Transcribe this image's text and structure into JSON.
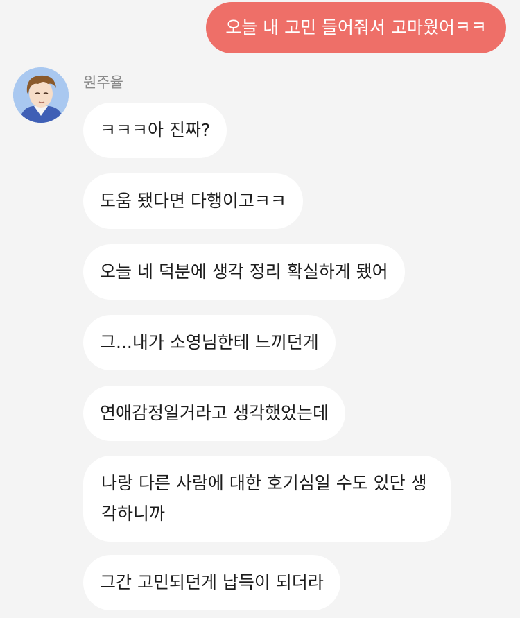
{
  "chat": {
    "sent_message": "오늘 내 고민 들어줘서 고마웠어ㅋㅋ",
    "sender_name": "원주율",
    "messages": [
      "ㅋㅋㅋ아 진짜?",
      "도움 됐다면 다행이고ㅋㅋ",
      "오늘 네 덕분에 생각 정리 확실하게 됐어",
      "그...내가 소영님한테 느끼던게",
      "연애감정일거라고 생각했었는데",
      "나랑 다른 사람에 대한 호기심일 수도 있단 생각하니까",
      "그간 고민되던게 납득이 되더라"
    ]
  },
  "colors": {
    "background": "#f4f4f4",
    "sent_bubble": "#ee6f68",
    "received_bubble": "#ffffff"
  }
}
